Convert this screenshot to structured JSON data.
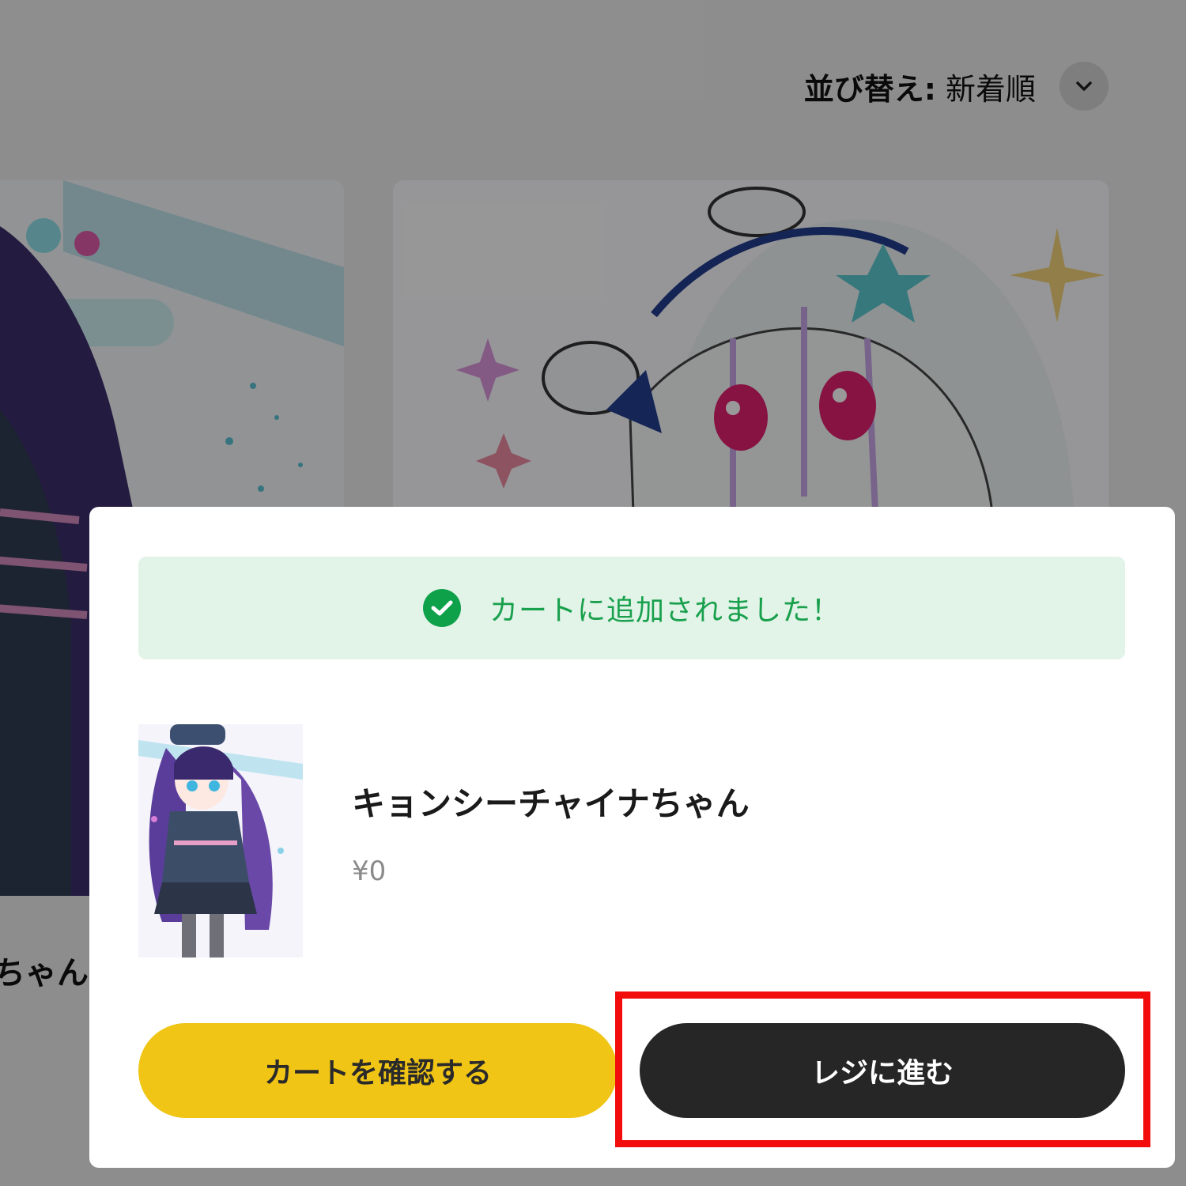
{
  "sort": {
    "label": "並び替え:",
    "value": "新着順",
    "toggle_icon": "chevron-down-icon"
  },
  "listing": {
    "left_card_title_fragment": "ちゃん"
  },
  "modal": {
    "notice": {
      "icon": "check-circle-icon",
      "text": "カートに追加されました！",
      "color": "#18a04c"
    },
    "product": {
      "name": "キョンシーチャイナちゃん",
      "price": "¥0"
    },
    "buttons": {
      "view_cart": "カートを確認する",
      "checkout": "レジに進む"
    }
  },
  "colors": {
    "primary_button": "#f0c515",
    "checkout_button": "#262626",
    "highlight_box": "#f20c0c",
    "success_bg": "#e2f3e8"
  }
}
